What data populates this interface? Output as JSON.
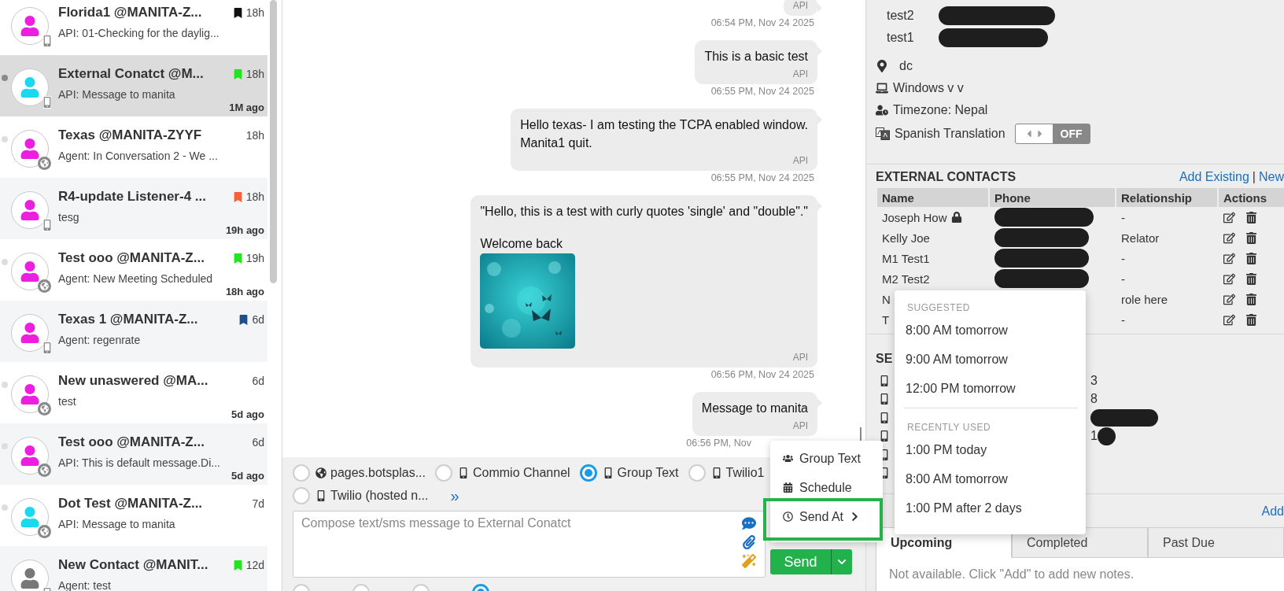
{
  "conversations": [
    {
      "name": "Florida1 @MANITA-Z...",
      "preview": "API: 01-Checking for the daylig...",
      "time": "18h",
      "flag": {
        "color": "#111111"
      },
      "color": "#ee1ee0",
      "kind": "phone",
      "selected": false
    },
    {
      "name": "External Conatct @M...",
      "preview": "API: Message to manita",
      "time": "18h",
      "flag": {
        "color": "#22e51d"
      },
      "ago": "1M ago",
      "color": "#1ad9ee",
      "kind": "phone",
      "dot": {
        "color": "#8a8a8a"
      },
      "selected": true
    },
    {
      "name": "Texas @MANITA-ZYYF",
      "preview": "Agent: In Conversation 2 - We ...",
      "time": "18h",
      "color": "#ee1ee0",
      "kind": "web",
      "dot": {
        "color": "#dedede"
      },
      "selected": false
    },
    {
      "name": "R4-update Listener-4 ...",
      "preview": "tesg",
      "time": "18h",
      "flag": {
        "color": "#f4623a"
      },
      "ago": "19h ago",
      "color": "#ee1ee0",
      "kind": "phone",
      "selected": false
    },
    {
      "name": "Test ooo @MANITA-Z...",
      "preview": "Agent: New Meeting Scheduled",
      "time": "19h",
      "flag": {
        "color": "#22e51d"
      },
      "ago": "18h ago",
      "color": "#ee1ee0",
      "kind": "web",
      "dot": {
        "color": "#dedede"
      },
      "selected": false
    },
    {
      "name": "Texas 1 @MANITA-Z...",
      "preview": "Agent: regenrate",
      "time": "6d",
      "flag": {
        "color": "#1b4f8f"
      },
      "color": "#ee1ee0",
      "kind": "phone",
      "selected": false
    },
    {
      "name": "New unaswered @MA...",
      "preview": "test",
      "time": "6d",
      "ago": "5d ago",
      "color": "#ee1ee0",
      "kind": "web",
      "dot": {
        "color": "#dedede"
      },
      "selected": false
    },
    {
      "name": "Test ooo @MANITA-Z...",
      "preview": "API: This is default message.Di...",
      "time": "6d",
      "ago": "5d ago",
      "color": "#ee1ee0",
      "kind": "web",
      "dot": {
        "color": "#dedede"
      },
      "selected": false
    },
    {
      "name": "Dot Test @MANITA-Z...",
      "preview": "API: Message to manita",
      "time": "7d",
      "color": "#1ad9ee",
      "kind": "web",
      "dot": {
        "color": "#dedede"
      },
      "selected": false
    },
    {
      "name": "New Contact @MANIT...",
      "preview": "Agent: test",
      "time": "12d",
      "flag": {
        "color": "#22e51d"
      },
      "color": "#777777",
      "kind": "phone",
      "selected": false
    }
  ],
  "messages": [
    {
      "source": "API",
      "time": "06:54 PM, Nov 24 2025"
    },
    {
      "paragraphs": [
        [
          "This is a basic test"
        ]
      ],
      "source": "API",
      "time": "06:55 PM, Nov 24 2025"
    },
    {
      "paragraphs": [
        [
          "Hello texas- I am testing the TCPA enabled window.",
          "Manita1 quit."
        ]
      ],
      "source": "API",
      "time": "06:55 PM, Nov 24 2025"
    },
    {
      "paragraphs": [
        [
          "\"Hello, this is a test with curly quotes 'single' and \"double\".\""
        ],
        [
          "Welcome back"
        ]
      ],
      "attachment": {
        "kind": "picture"
      },
      "source": "API",
      "time": "06:56 PM, Nov 24 2025"
    },
    {
      "paragraphs": [
        [
          "Message to manita"
        ]
      ],
      "source": "API",
      "time": "06:56 PM, Nov"
    }
  ],
  "compose": {
    "channels": [
      {
        "label": "pages.botsplas...",
        "kind": "web",
        "selected": false
      },
      {
        "label": "Commio Channel",
        "kind": "phone",
        "selected": false
      },
      {
        "label": "Group Text",
        "kind": "phone",
        "selected": true
      },
      {
        "label": "Twilio1",
        "kind": "phone",
        "selected": false
      },
      {
        "label": "Twilio (hosted n...",
        "kind": "phone",
        "selected": false
      }
    ],
    "more": "»",
    "placeholder": "Compose text/sms message to External Conatct",
    "send": "Send",
    "groups": [
      {
        "selected": false
      },
      {
        "selected": false
      },
      {
        "selected": false
      },
      {
        "selected": true
      }
    ]
  },
  "send_menu": [
    {
      "kind": "group",
      "label": "Group Text",
      "highlighted": false
    },
    {
      "kind": "calendar",
      "label": "Schedule",
      "highlighted": false
    },
    {
      "kind": "clock",
      "label": "Send At",
      "submenu": true,
      "highlighted": true
    }
  ],
  "send_at_menu": [
    {
      "title": "SUGGESTED",
      "items": [
        "8:00 AM tomorrow",
        "9:00 AM tomorrow",
        "12:00 PM tomorrow"
      ]
    },
    {
      "title": "RECENTLY USED",
      "items": [
        "1:00 PM today",
        "8:00 AM tomorrow",
        "1:00 PM after 2 days"
      ]
    }
  ],
  "contact": {
    "phones": [
      {
        "label": "test2"
      },
      {
        "label": "test1"
      }
    ],
    "info": [
      {
        "kind": "location",
        "text": "dc"
      },
      {
        "kind": "device",
        "text": "Windows v v"
      },
      {
        "kind": "timezone",
        "text": "Timezone: Nepal"
      }
    ],
    "translation": {
      "label": "Spanish Translation",
      "on": false,
      "state_label": "OFF"
    }
  },
  "external_contacts": {
    "title": "EXTERNAL CONTACTS",
    "links": [
      "Add Existing",
      "New"
    ],
    "separator": "|",
    "columns": [
      "Name",
      "Phone",
      "Relationship",
      "Actions"
    ],
    "rows": [
      {
        "name": "Joseph How",
        "locked": true,
        "phone_redacted": true,
        "relationship": "-"
      },
      {
        "name": "Kelly Joe",
        "locked": false,
        "phone_redacted": true,
        "relationship": "Relator"
      },
      {
        "name": "M1 Test1",
        "locked": false,
        "phone_redacted": true,
        "relationship": "-"
      },
      {
        "name": "M2 Test2",
        "locked": false,
        "phone_redacted": true,
        "relationship": "-"
      },
      {
        "name": "N",
        "locked": false,
        "phone_redacted": false,
        "relationship": "role here"
      },
      {
        "name": "T",
        "locked": false,
        "phone_redacted": false,
        "relationship": "-"
      }
    ]
  },
  "section_2": {
    "title": "SE",
    "rows": [
      {
        "kind": "value",
        "value": "3"
      },
      {
        "kind": "value",
        "value": "8"
      },
      {
        "kind": "redacted"
      },
      {
        "kind": "value_redacted",
        "value": "1"
      },
      {
        "kind": "blank"
      },
      {
        "kind": "blank"
      }
    ]
  },
  "notes": {
    "add": "Add",
    "tabs": [
      {
        "label": "Upcoming",
        "selected": true
      },
      {
        "label": "Completed",
        "selected": false
      },
      {
        "label": "Past Due",
        "selected": false
      }
    ],
    "empty": "Not available. Click \"Add\" to add new notes."
  }
}
